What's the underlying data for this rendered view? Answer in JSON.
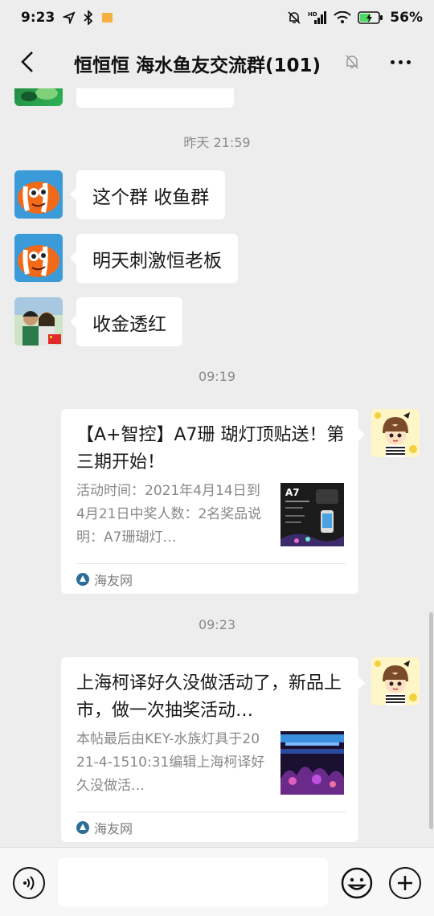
{
  "status_bar": {
    "time": "9:23",
    "battery": "56%",
    "icons": [
      "navigation-icon",
      "bluetooth-icon",
      "notification-flag-icon",
      "mute-icon",
      "signal-icon",
      "wifi-icon",
      "battery-icon"
    ],
    "network_label": "HD"
  },
  "nav": {
    "title": "恒恒恒  海水鱼友交流群(101)",
    "icons": [
      "back-arrow-icon",
      "muted-bell-icon",
      "more-dots-icon"
    ]
  },
  "messages": [
    {
      "type": "timestamp",
      "text": "昨天 21:59"
    },
    {
      "type": "text",
      "side": "left",
      "sender_avatar": "clownfish-avatar",
      "text": "这个群 收鱼群"
    },
    {
      "type": "text",
      "side": "left",
      "sender_avatar": "clownfish-avatar",
      "text": "明天刺激恒老板"
    },
    {
      "type": "text",
      "side": "left",
      "sender_avatar": "couple-photo-avatar",
      "text": "收金透红"
    },
    {
      "type": "timestamp",
      "text": "09:19"
    },
    {
      "type": "link_card",
      "side": "right",
      "sender_avatar": "cartoon-boy-avatar",
      "title": "【A+智控】A7珊 瑚灯顶贴送！第三期开始！",
      "description": "活动时间：2021年4月14日到4月21日中奖人数：2名奖品说明：A7珊瑚灯…",
      "thumb_label": "A7",
      "source": "海友网"
    },
    {
      "type": "timestamp",
      "text": "09:23"
    },
    {
      "type": "link_card",
      "side": "right",
      "sender_avatar": "cartoon-boy-avatar",
      "title": "上海柯译好久没做活动了，新品上市，做一次抽奖活动…",
      "description": "本帖最后由KEY-水族灯具于2021-4-1510:31编辑上海柯译好久没做活…",
      "source": "海友网"
    }
  ],
  "input_bar": {
    "placeholder": "",
    "icons": [
      "voice-icon",
      "emoji-icon",
      "plus-icon"
    ]
  },
  "colors": {
    "background": "#ededed",
    "bubble": "#ffffff",
    "timestamp": "#8a8a8a",
    "battery_green": "#4cd964"
  }
}
